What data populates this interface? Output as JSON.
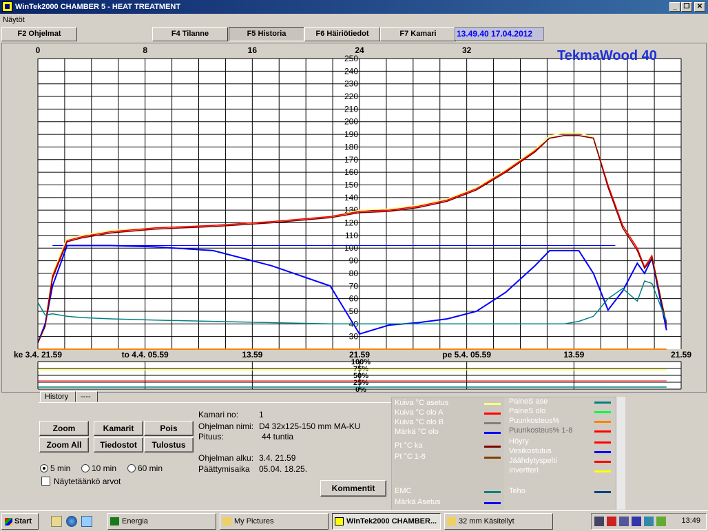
{
  "window": {
    "title": "WinTek2000 CHAMBER 5 - HEAT TREATMENT",
    "buttons": {
      "minimize": "_",
      "restore": "❐",
      "close": "✕"
    }
  },
  "menu": {
    "item": "Näytöt"
  },
  "fkeys": [
    "F2 Ohjelmat",
    "F4 Tilanne",
    "F5 Historia",
    "F6 Häiriötiedot",
    "F7 Kamari"
  ],
  "clock": "13.49.40 17.04.2012",
  "brand": "TekmaWood 40",
  "chart": {
    "top_hours": [
      "0",
      "8",
      "16",
      "24",
      "32"
    ],
    "y_ticks": [
      "250",
      "240",
      "230",
      "220",
      "210",
      "200",
      "190",
      "180",
      "170",
      "160",
      "150",
      "140",
      "130",
      "120",
      "110",
      "100",
      "90",
      "80",
      "70",
      "60",
      "50",
      "40",
      "30"
    ],
    "y_low_ticks": [
      "50",
      "40",
      "30"
    ],
    "x_labels": [
      "ke 3.4. 21.59",
      "to 4.4. 05.59",
      "13.59",
      "21.59",
      "pe 5.4. 05.59",
      "13.59",
      "21.59"
    ],
    "pct_ticks": [
      "100%",
      "75%",
      "50%",
      "25%",
      "0%"
    ]
  },
  "chart_data": {
    "type": "line",
    "xlabel": "",
    "ylabel": "",
    "xlim": [
      0,
      44
    ],
    "ylim": [
      20,
      250
    ],
    "x": [
      0,
      0.5,
      1,
      2,
      3,
      5,
      8,
      12,
      16,
      20,
      22,
      24,
      26,
      28,
      30,
      32,
      34,
      35,
      36,
      37,
      38,
      39,
      40,
      41,
      41.5,
      42,
      43
    ],
    "series": [
      {
        "name": "Kuiva °C asetus",
        "color": "#ffff80",
        "values": [
          25,
          40,
          80,
          108,
          110,
          114,
          116,
          118,
          121,
          125,
          130,
          131,
          134,
          139,
          148,
          162,
          178,
          189,
          191,
          191,
          188,
          150,
          118,
          100,
          85,
          95,
          40
        ]
      },
      {
        "name": "Kuiva °C olo A",
        "color": "#ff0000",
        "values": [
          25,
          40,
          78,
          106,
          109,
          113,
          116,
          118,
          121,
          125,
          129,
          130,
          133,
          138,
          147,
          161,
          177,
          187,
          189,
          189,
          187,
          150,
          118,
          100,
          85,
          94,
          38
        ]
      },
      {
        "name": "Märkä °C olo",
        "color": "#0000ff",
        "values": [
          25,
          40,
          70,
          102,
          102,
          102,
          101,
          98,
          86,
          70,
          32,
          39,
          41,
          44,
          50,
          65,
          86,
          98,
          98,
          98,
          80,
          51,
          66,
          88,
          80,
          92,
          35
        ]
      },
      {
        "name": "Pt °C ka",
        "color": "#800000",
        "values": [
          25,
          38,
          76,
          105,
          108,
          112,
          115,
          117,
          120,
          124,
          128,
          129,
          132,
          137,
          146,
          160,
          176,
          187,
          189,
          189,
          187,
          148,
          116,
          98,
          84,
          92,
          40
        ]
      },
      {
        "name": "EMC",
        "color": "#008080",
        "values": [
          57,
          47,
          48,
          46,
          45,
          44,
          43,
          42,
          41,
          40,
          40,
          40,
          40,
          40,
          40,
          40,
          40,
          40,
          40,
          42,
          46,
          60,
          68,
          58,
          74,
          72,
          42
        ]
      }
    ]
  },
  "tabs": [
    "History",
    "----"
  ],
  "buttons": {
    "zoom": "Zoom",
    "kamarit": "Kamarit",
    "pois": "Pois",
    "zoom_all": "Zoom All",
    "tiedostot": "Tiedostot",
    "tulostus": "Tulostus",
    "kommentit": "Kommentit"
  },
  "radios": [
    "5 min",
    "10 min",
    "60 min"
  ],
  "checkbox": "Näytetäänkö arvot",
  "info": {
    "kamari_label": "Kamari no:",
    "kamari_value": "1",
    "nimi_label": "Ohjelman nimi:",
    "nimi_value": "D4 32x125-150 mm MA-KU",
    "pituus_label": "Pituus:",
    "pituus_value": "44 tuntia",
    "alku_label": "Ohjelman alku:",
    "alku_value": "3.4.  21.59",
    "loppu_label": "Päättymisaika",
    "loppu_value": "05.04.  18.25."
  },
  "legend_left": [
    {
      "label": "Kuiva °C asetus",
      "color": "#ffff80"
    },
    {
      "label": "Kuiva °C olo A",
      "color": "#ff0000"
    },
    {
      "label": "Kuiva °C olo B",
      "color": "#808080"
    },
    {
      "label": "Märkä °C olo",
      "color": "#0000ff"
    },
    {
      "label": "Pt °C ka",
      "color": "#800000"
    },
    {
      "label": "Pt °C 1-8",
      "color": "#804000"
    },
    {
      "label": "EMC",
      "color": "#008080"
    },
    {
      "label": "Märkä Asetus",
      "color": "#0000ff"
    }
  ],
  "legend_right": [
    {
      "label": "PaineS ase",
      "color": "#008080"
    },
    {
      "label": "PaineS olo",
      "color": "#00ff40"
    },
    {
      "label": "Puunkosteus%",
      "color": "#ff8000"
    },
    {
      "label": "Puunkosteus% 1-8",
      "color": "#ff0000"
    },
    {
      "label": "Höyry",
      "color": "#ff0000"
    },
    {
      "label": "Vesikostutus",
      "color": "#0000ff"
    },
    {
      "label": "Jäähdytyspelti",
      "color": "#ff0000"
    },
    {
      "label": "Invertteri",
      "color": "#ffff00"
    },
    {
      "label": "Teho",
      "color": "#004080"
    }
  ],
  "taskbar": {
    "start": "Start",
    "tasks": [
      "Energia",
      "My Pictures",
      "WinTek2000 CHAMBER...",
      "32 mm Käsitellyt"
    ],
    "time": "13:49"
  }
}
